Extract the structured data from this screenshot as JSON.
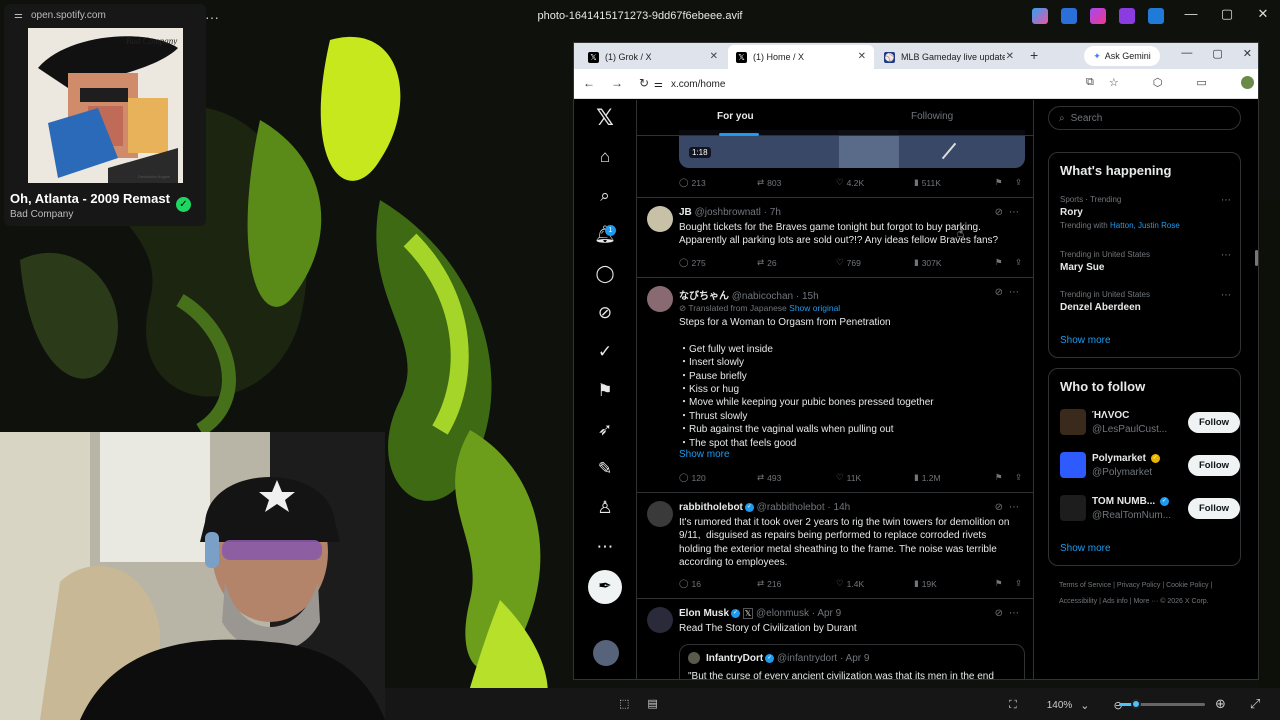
{
  "viewer": {
    "title": "photo-1641415171273-9dd67f6ebeee.avif",
    "window_controls": [
      "—",
      "▢",
      "✕"
    ],
    "zoom": "140%"
  },
  "spotify": {
    "url": "open.spotify.com",
    "album_title": "Bad Company",
    "album_subtitle": "Desolation Angels",
    "song": "Oh, Atlanta - 2009 Remaster",
    "artist": "Bad Company"
  },
  "browser": {
    "tabs": [
      {
        "label": "(1) Grok / X",
        "icon": "x-logo-icon"
      },
      {
        "label": "(1) Home / X",
        "icon": "x-logo-icon"
      },
      {
        "label": "MLB Gameday live updates",
        "icon": "mlb-logo-icon"
      }
    ],
    "ask_gemini": "Ask Gemini",
    "url": "x.com/home"
  },
  "feed": {
    "tab_foryou": "For you",
    "tab_following": "Following",
    "video_time": "1:18",
    "post0_actions": {
      "replies": "213",
      "reposts": "803",
      "likes": "4.2K",
      "views": "511K"
    },
    "posts": [
      {
        "name": "JB",
        "handle": "@joshbrownatl · 7h",
        "text": "Bought tickets for the Braves game tonight but forgot to buy parking.\nApparently all parking lots are sold out?!? Any ideas fellow Braves fans?",
        "replies": "275",
        "reposts": "26",
        "likes": "769",
        "views": "307K"
      },
      {
        "name": "なびちゃん",
        "handle": "@nabicochan · 15h",
        "translated": "Translated from Japanese",
        "show_original": "Show original",
        "text": "Steps for a Woman to Orgasm from Penetration\n\n・Get fully wet inside\n・Insert slowly\n・Pause briefly\n・Kiss or hug\n・Move while keeping your pubic bones pressed together\n・Thrust slowly\n・Rub against the vaginal walls when pulling out\n・The spot that feels good",
        "show_more": "Show more",
        "replies": "120",
        "reposts": "493",
        "likes": "11K",
        "views": "1.2M"
      },
      {
        "name": "rabbitholebot",
        "handle": "@rabbitholebot · 14h",
        "text": "It's rumored that it took over 2 years to rig the twin towers for demolition on\n9/11,  disguised as repairs being performed to replace corroded rivets\nholding the exterior metal sheathing to the frame. The noise was terrible\naccording to employees.",
        "replies": "16",
        "reposts": "216",
        "likes": "1.4K",
        "views": "19K"
      },
      {
        "name": "Elon Musk",
        "handle": "@elonmusk · Apr 9",
        "text": "Read The Story of Civilization by Durant",
        "quote_name": "InfantryDort",
        "quote_handle": "@infantrydort · Apr 9",
        "quote_text": "\"But the curse of every ancient civilization was that its men in the end"
      }
    ]
  },
  "sidebar": {
    "search_placeholder": "Search",
    "whats_happening": "What's happening",
    "trends": [
      {
        "meta": "Sports · Trending",
        "name": "Rory",
        "with_label": "Trending with",
        "with": "Hatton, Justin Rose"
      },
      {
        "meta": "Trending in United States",
        "name": "Mary Sue"
      },
      {
        "meta": "Trending in United States",
        "name": "Denzel Aberdeen"
      }
    ],
    "show_more": "Show more",
    "who_to_follow": "Who to follow",
    "follow_suggestions": [
      {
        "name": "ΉΛVOC",
        "handle": "@LesPaulCust...",
        "button": "Follow",
        "color": "#3a2a1c"
      },
      {
        "name": "Polymarket",
        "handle": "@Polymarket",
        "button": "Follow",
        "color": "#2e5bff"
      },
      {
        "name": "TOM NUMB...",
        "handle": "@RealTomNum...",
        "button": "Follow",
        "color": "#1d1d1d"
      }
    ],
    "footer": "Terms of Service  |  Privacy Policy  |  Cookie Policy  |  Accessibility  |  Ads info  |  More ···  © 2026 X Corp."
  },
  "colors": {
    "accent": "#1d9bf0",
    "spotify_green": "#1ed760",
    "wallpaper_green": "#7cc21a"
  }
}
